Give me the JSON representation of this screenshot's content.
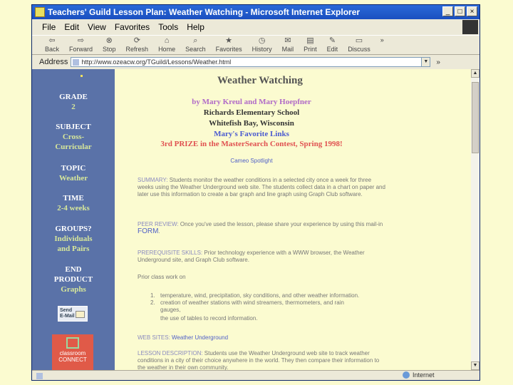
{
  "window": {
    "title": "Teachers' Guild Lesson Plan: Weather Watching - Microsoft Internet Explorer",
    "min": "_",
    "max": "□",
    "close": "×"
  },
  "menu": [
    "File",
    "Edit",
    "View",
    "Favorites",
    "Tools",
    "Help"
  ],
  "toolbar": {
    "back": "Back",
    "forward": "Forward",
    "stop": "Stop",
    "refresh": "Refresh",
    "home": "Home",
    "search": "Search",
    "favorites": "Favorites",
    "history": "History",
    "mail": "Mail",
    "print": "Print",
    "edit": "Edit",
    "discuss": "Discuss",
    "more": "»"
  },
  "address": {
    "label": "Address",
    "url": "http://www.ozeacw.org/TGuild/Lessons/Weather.html",
    "links": "»"
  },
  "sidebar": {
    "grade_h": "GRADE",
    "grade_v": "2",
    "subject_h": "SUBJECT",
    "subject_v1": "Cross-",
    "subject_v2": "Curricular",
    "topic_h": "TOPIC",
    "topic_v": "Weather",
    "time_h": "TIME",
    "time_v": "2-4 weeks",
    "groups_h": "GROUPS?",
    "groups_v1": "Individuals",
    "groups_v2": "and Pairs",
    "end_h1": "END",
    "end_h2": "PRODUCT",
    "end_v": "Graphs",
    "send_l1": "Send",
    "send_l2": "E-Mail",
    "logo_l1": "classroom",
    "logo_l2": "CONNECT"
  },
  "main": {
    "title": "Weather Watching",
    "by": "by Mary Kreul and Mary Hoepfner",
    "school": "Richards Elementary School",
    "city": "Whitefish Bay, Wisconsin",
    "fav": "Mary's Favorite Links",
    "prize": "3rd PRIZE in the MasterSearch Contest, Spring 1998!",
    "cameo": "Cameo Spotlight",
    "summary_label": "SUMMARY:",
    "summary_text": " Students monitor the weather conditions in a selected city once a week for three weeks using the Weather Underground web site. The students collect data in a chart on paper and later use this information to create a bar graph and line graph using Graph Club software.",
    "peer_label": "PEER REVIEW:",
    "peer_text": " Once you've used the lesson, please share your experience by using this mail-in ",
    "peer_form": "FORM",
    "peer_end": ".",
    "prereq_label": "PREREQUISITE SKILLS:",
    "prereq_text": " Prior technology experience with a WWW browser, the Weather Underground site, and Graph Club software.",
    "prior": "Prior class work on",
    "li1_num": "1.",
    "li1": "temperature, wind, precipitation, sky conditions, and other weather information.",
    "li2_num": "2.",
    "li2": "creation of weather stations with wind streamers, thermometers, and rain",
    "li2b": "gauges,",
    "li3": "the use of tables to record information.",
    "web_label": "WEB SITES:",
    "web_link": " Weather Underground",
    "lesson_label": "LESSON DESCRIPTION:",
    "lesson_text": " Students use the Weather Underground web site to track weather conditions in a city of their choice anywhere in the world. They then compare",
    "lesson_text2": "their information to the weather in their own community."
  },
  "status": {
    "zone": "Internet"
  }
}
